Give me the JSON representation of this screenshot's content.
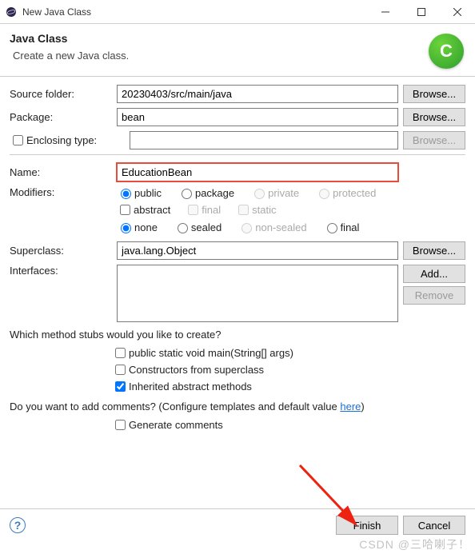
{
  "window": {
    "title": "New Java Class"
  },
  "header": {
    "title": "Java Class",
    "subtitle": "Create a new Java class.",
    "badge": "C"
  },
  "fields": {
    "sourceFolder": {
      "label": "Source folder:",
      "value": "20230403/src/main/java"
    },
    "package": {
      "label": "Package:",
      "value": "bean"
    },
    "enclosing": {
      "label": "Enclosing type:",
      "value": ""
    },
    "name": {
      "label": "Name:",
      "value": "EducationBean"
    },
    "modifiers": {
      "label": "Modifiers:"
    },
    "superclass": {
      "label": "Superclass:",
      "value": "java.lang.Object"
    },
    "interfaces": {
      "label": "Interfaces:"
    }
  },
  "options": {
    "access": {
      "public": "public",
      "package": "package",
      "private": "private",
      "protected": "protected"
    },
    "abstract": "abstract",
    "final": "final",
    "static": "static",
    "sealed": {
      "none": "none",
      "sealed": "sealed",
      "nonsealed": "non-sealed",
      "final": "final"
    }
  },
  "buttons": {
    "browse": "Browse...",
    "add": "Add...",
    "remove": "Remove",
    "finish": "Finish",
    "cancel": "Cancel"
  },
  "stubs": {
    "question": "Which method stubs would you like to create?",
    "main": "public static void main(String[] args)",
    "constructors": "Constructors from superclass",
    "inherited": "Inherited abstract methods"
  },
  "comments": {
    "question_pre": "Do you want to add comments? (Configure templates and default value ",
    "link": "here",
    "question_post": ")",
    "generate": "Generate comments"
  },
  "watermark": "CSDN @三哈喇子！"
}
